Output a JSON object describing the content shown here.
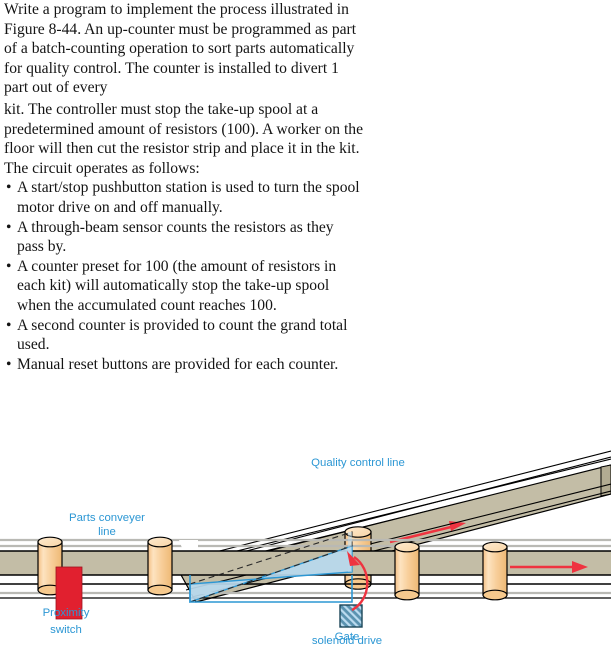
{
  "document": {
    "paragraphs": [
      "Write a program to implement the process illustrated in Figure 8-44. An up-counter must be programmed as part of a batch-counting operation to sort parts automatically for quality control. The counter is installed to divert 1 part out of every",
      "kit. The controller must stop the take-up spool at a predetermined amount of resistors (100). A worker on the floor will then cut the resistor strip and place it in the kit. The circuit operates as follows:"
    ],
    "bullet_char": "•",
    "bullets": [
      "A start/stop pushbutton station is used to turn the spool motor drive on and off manually.",
      "A through-beam sensor counts the resistors as they pass by.",
      "A counter preset for 100 (the amount of resistors in each kit) will automatically stop the take-up spool when the accumulated count reaches 100.",
      "A second counter is provided to count the grand total used.",
      "Manual reset buttons are provided for each counter."
    ]
  },
  "figure": {
    "labels": {
      "quality_control_line": "Quality control line",
      "parts_conveyer_line_1": "Parts conveyer",
      "parts_conveyer_line_2": "line",
      "proximity_switch_1": "Proximity",
      "proximity_switch_2": "switch",
      "gate_1": "Gate",
      "gate_2": "solenoid drive"
    },
    "colors": {
      "label_blue": "#2c97d4",
      "belt_tan": "#c3bda6",
      "belt_tan_dark": "#b2ab92",
      "roller_light": "#fbdfb8",
      "roller_mid": "#f6c98d",
      "roller_edge": "#eeb874",
      "proximity_red": "#e1202f",
      "arrow_red": "#ef3340",
      "gate_fill": "#b9d9ee",
      "gate_stroke": "#2c97d4",
      "solenoid_fill": "#5b93b0",
      "solenoid_hatch": "#bcdcf0",
      "rail_gray": "#b9b9b4",
      "outline": "#000000"
    },
    "elements": {
      "arrows": [
        {
          "name": "quality-control-flow-arrow",
          "direction": "right"
        },
        {
          "name": "parts-conveyer-flow-arrow",
          "direction": "right"
        },
        {
          "name": "gate-actuation-arrow",
          "direction": "curved-up"
        }
      ],
      "rollers_parts_line": 4,
      "rollers_quality_line": 1
    }
  }
}
